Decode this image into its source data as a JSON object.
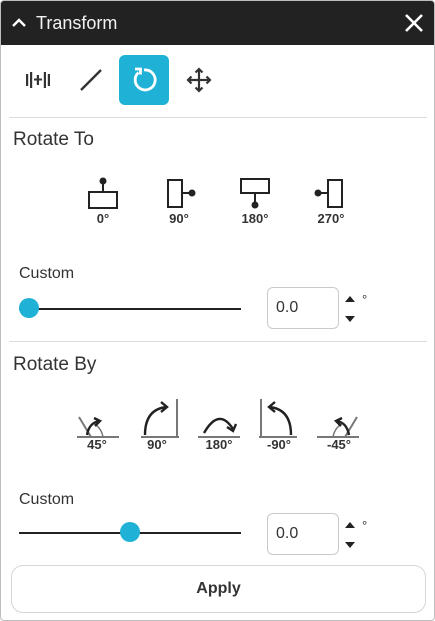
{
  "window": {
    "title": "Transform"
  },
  "icons": {
    "collapse": "chevron-up-icon",
    "close": "close-icon",
    "tools": [
      "distribute-icon",
      "resize-line-icon",
      "rotate-icon",
      "move-icon"
    ]
  },
  "accent_color": "#1fb2d6",
  "rotate_to": {
    "title": "Rotate To",
    "options": [
      {
        "label": "0°"
      },
      {
        "label": "90°"
      },
      {
        "label": "180°"
      },
      {
        "label": "270°"
      }
    ],
    "custom_label": "Custom",
    "slider_fraction": 0.0,
    "value": "0.0",
    "unit": "°"
  },
  "rotate_by": {
    "title": "Rotate By",
    "options": [
      {
        "label": "45°"
      },
      {
        "label": "90°"
      },
      {
        "label": "180°"
      },
      {
        "label": "-90°"
      },
      {
        "label": "-45°"
      }
    ],
    "custom_label": "Custom",
    "slider_fraction": 0.5,
    "value": "0.0",
    "unit": "°"
  },
  "apply_label": "Apply"
}
